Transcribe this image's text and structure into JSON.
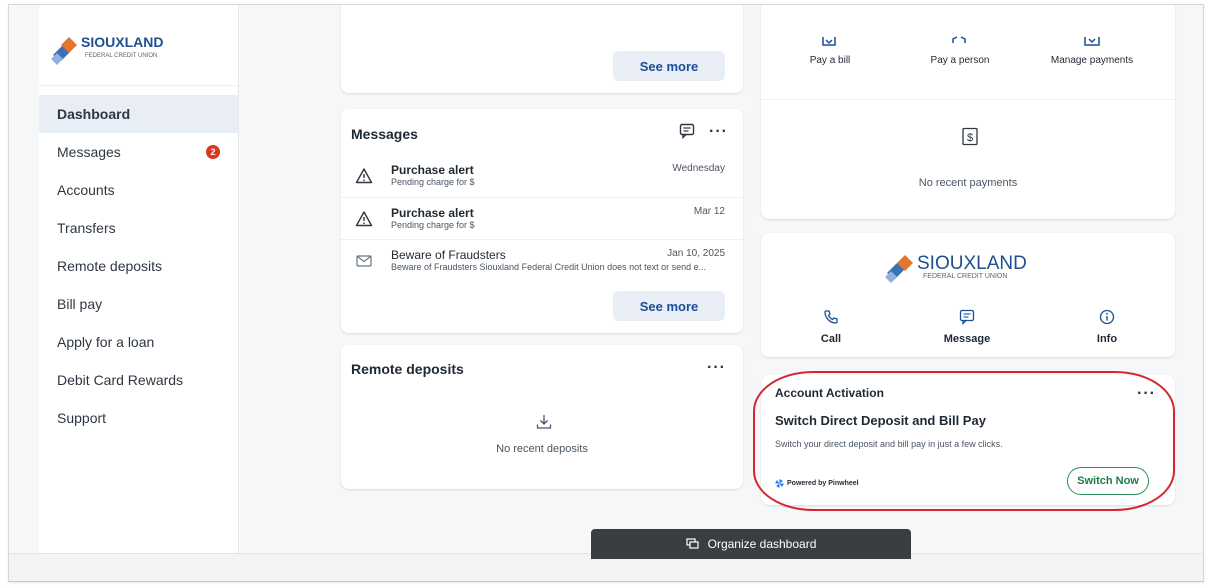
{
  "sidebar": {
    "logo_text": "SIOUXLAND",
    "logo_subtext": "FEDERAL CREDIT UNION",
    "items": [
      {
        "label": "Dashboard"
      },
      {
        "label": "Messages",
        "badge": "2"
      },
      {
        "label": "Accounts"
      },
      {
        "label": "Transfers"
      },
      {
        "label": "Remote deposits"
      },
      {
        "label": "Bill pay"
      },
      {
        "label": "Apply for a loan"
      },
      {
        "label": "Debit Card Rewards"
      },
      {
        "label": "Support"
      }
    ]
  },
  "top_card": {
    "see_more": "See more"
  },
  "messages": {
    "title": "Messages",
    "items": [
      {
        "icon": "warning-icon",
        "title": "Purchase alert",
        "subtitle": "Pending charge for $",
        "date": "Wednesday"
      },
      {
        "icon": "warning-icon",
        "title": "Purchase alert",
        "subtitle": "Pending charge for $",
        "date": "Mar 12"
      },
      {
        "icon": "mail-icon",
        "title": "Beware of Fraudsters",
        "subtitle": "Beware of Fraudsters Siouxland Federal Credit Union does not text or send e...",
        "date": "Jan 10, 2025"
      }
    ],
    "see_more": "See more"
  },
  "remote_deposits": {
    "title": "Remote deposits",
    "empty": "No recent deposits"
  },
  "bill_pay": {
    "actions": [
      "Pay a bill",
      "Pay a person",
      "Manage payments"
    ],
    "empty": "No recent payments"
  },
  "contact": {
    "logo_text": "SIOUXLAND",
    "logo_subtext": "FEDERAL CREDIT UNION",
    "actions": [
      "Call",
      "Message",
      "Info"
    ]
  },
  "activation": {
    "title": "Account Activation",
    "heading": "Switch Direct Deposit and Bill Pay",
    "description": "Switch your direct deposit and bill pay in just a few clicks.",
    "powered_by": "Powered by Pinwheel",
    "button": "Switch Now"
  },
  "organize_button": "Organize dashboard",
  "colors": {
    "accent": "#1a4f95",
    "badge": "#d9381e",
    "highlight_outline": "#d6252f",
    "switch_green": "#1f7a47"
  }
}
